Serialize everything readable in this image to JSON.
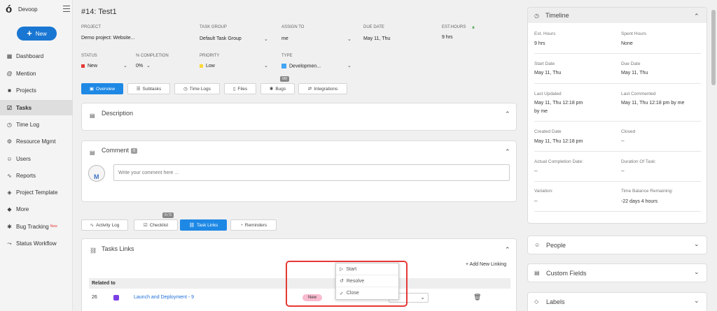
{
  "app": {
    "name": "Devoop",
    "new_label": "New"
  },
  "sidebar": {
    "items": [
      {
        "label": "Dashboard",
        "icon": "dashboard-icon"
      },
      {
        "label": "Mention",
        "icon": "at-icon"
      },
      {
        "label": "Projects",
        "icon": "briefcase-icon"
      },
      {
        "label": "Tasks",
        "icon": "checkbox-icon",
        "active": true
      },
      {
        "label": "Time Log",
        "icon": "clock-icon"
      },
      {
        "label": "Resource Mgmt",
        "icon": "gear-icon"
      },
      {
        "label": "Users",
        "icon": "user-icon"
      },
      {
        "label": "Reports",
        "icon": "chart-line-icon"
      },
      {
        "label": "Project Template",
        "icon": "layers-icon"
      },
      {
        "label": "More",
        "icon": "stack-icon"
      },
      {
        "label": "Bug Tracking",
        "icon": "bug-icon",
        "sup": "New"
      },
      {
        "label": "Status Workflow",
        "icon": "workflow-icon"
      }
    ]
  },
  "task": {
    "title": "#14: Test1",
    "project_label": "PROJECT",
    "project_value": "Demo project: Website...",
    "group_label": "TASK GROUP",
    "group_value": "Default Task Group",
    "assign_label": "ASSIGN TO",
    "assign_value": "me",
    "due_label": "DUE DATE",
    "due_value": "May 11, Thu",
    "est_label": "EST.HOURS",
    "est_value": "9 hrs",
    "status_label": "STATUS",
    "status_value": "New",
    "completion_label": "% COMPLETION",
    "completion_value": "0%",
    "priority_label": "PRIORITY",
    "priority_value": "Low",
    "type_label": "TYPE",
    "type_value": "Developmen..."
  },
  "tabs": {
    "overview": "Overview",
    "subtasks": "Subtasks",
    "timelogs": "Time Logs",
    "files": "Files",
    "bugs": "Bugs",
    "bugs_badge": "0/0",
    "integrations": "Integrations"
  },
  "description": {
    "title": "Description"
  },
  "comment": {
    "title": "Comment",
    "count": "0",
    "placeholder": "Write your comment here ..."
  },
  "tabs2": {
    "activity": "Activity Log",
    "checklist": "Checklist",
    "checklist_badge": "0 / 0",
    "tasklinks": "Task Links",
    "reminders": "Reminders"
  },
  "tasklinks": {
    "title": "Tasks Links",
    "add_label": "+ Add New Linking",
    "group_header": "Related to",
    "rows": [
      {
        "id": "26",
        "name": "Launch and Deployment - 9",
        "status": "New"
      }
    ]
  },
  "status_menu": {
    "options": [
      {
        "icon": "play-icon",
        "glyph": "▷",
        "label": "Start"
      },
      {
        "icon": "history-icon",
        "glyph": "↺",
        "label": "Resolve"
      },
      {
        "icon": "check-icon",
        "glyph": "✓",
        "label": "Close"
      }
    ]
  },
  "timeline": {
    "title": "Timeline",
    "est_hours_label": "Est. Hours",
    "est_hours_value": "9 hrs",
    "spent_hours_label": "Spent Hours",
    "spent_hours_value": "None",
    "start_label": "Start Date",
    "start_value": "May 11, Thu",
    "due_label": "Due Date",
    "due_value": "May 11, Thu",
    "updated_label": "Last Updated",
    "updated_value": "May 11, Thu 12:18 pm",
    "updated_by": "by me",
    "commented_label": "Last Commented",
    "commented_value": "May 11, Thu 12:18 pm by me",
    "created_label": "Created Date",
    "created_value": "May 11, Thu 12:18 pm",
    "closed_label": "Closed",
    "closed_value": "--",
    "actual_label": "Actual Completion Date:",
    "actual_value": "--",
    "duration_label": "Duration Of Task:",
    "duration_value": "--",
    "variation_label": "Variation:",
    "variation_value": "--",
    "balance_label": "Time Balance Remaining:",
    "balance_value": "-22 days 4 hours"
  },
  "panels": {
    "people": "People",
    "custom_fields": "Custom Fields",
    "labels": "Labels"
  },
  "colors": {
    "accent": "#1e88e5",
    "status_new": "#e53935",
    "priority_low": "#fdd835",
    "highlight": "#e53935"
  }
}
